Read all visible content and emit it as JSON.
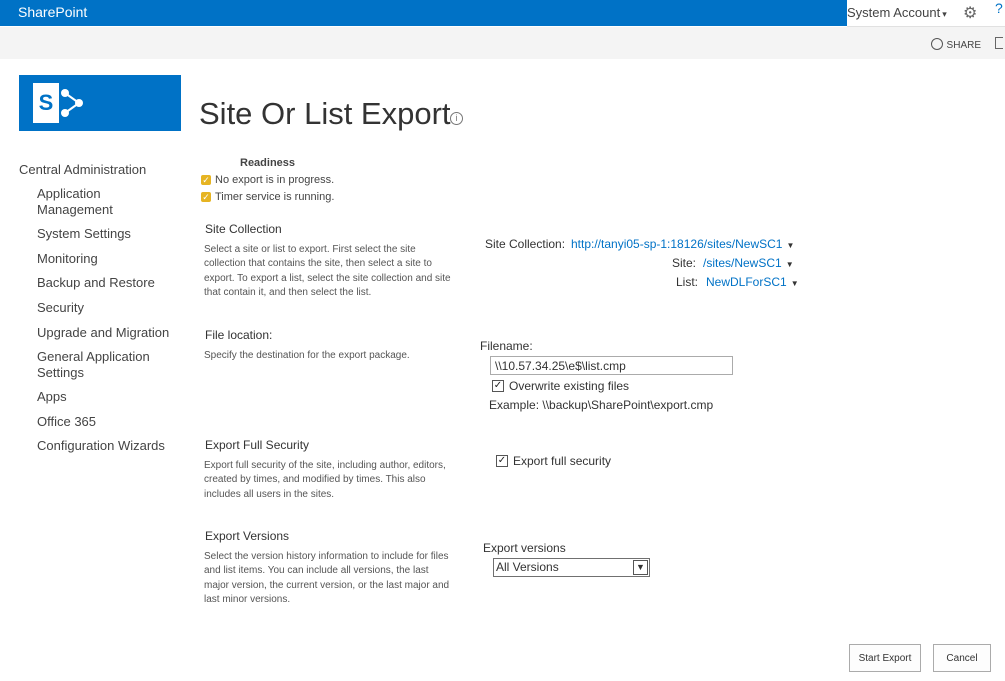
{
  "suite": {
    "brand": "SharePoint",
    "account": "System Account"
  },
  "ribbon": {
    "share": "SHARE"
  },
  "page": {
    "title": "Site Or List Export"
  },
  "nav": {
    "header": "Central Administration",
    "items": [
      "Application Management",
      "System Settings",
      "Monitoring",
      "Backup and Restore",
      "Security",
      "Upgrade and Migration",
      "General Application Settings",
      "Apps",
      "Office 365",
      "Configuration Wizards"
    ]
  },
  "readiness": {
    "title": "Readiness",
    "items": [
      "No export is in progress.",
      "Timer service is running."
    ]
  },
  "site_collection": {
    "title": "Site Collection",
    "description": "Select a site or list to export.  First select the site collection that contains the site, then select a site to export. To export a list, select the site collection and site that contain it, and then select the list.",
    "collection_label": "Site Collection:",
    "collection_value": "http://tanyi05-sp-1:18126/sites/NewSC1",
    "site_label": "Site:",
    "site_value": "/sites/NewSC1",
    "list_label": "List:",
    "list_value": "NewDLForSC1"
  },
  "file_location": {
    "title": "File location:",
    "description": "Specify the destination for the export package.",
    "filename_label": "Filename:",
    "filename_value": "\\\\10.57.34.25\\e$\\list.cmp",
    "overwrite_label": "Overwrite existing files",
    "overwrite_checked": true,
    "example": "Example: \\\\backup\\SharePoint\\export.cmp"
  },
  "security": {
    "title": "Export Full Security",
    "description": "Export full security of the site, including author, editors, created by times, and modified by times. This also includes all users in the sites.",
    "checkbox_label": "Export full security",
    "checked": true
  },
  "versions": {
    "title": "Export Versions",
    "description": "Select the version history information to include for files and list items. You can include all versions, the last major version, the current version, or the last major and last minor versions.",
    "label": "Export versions",
    "selected": "All Versions"
  },
  "buttons": {
    "start": "Start Export",
    "cancel": "Cancel"
  },
  "colors": {
    "accent": "#0072c6"
  }
}
